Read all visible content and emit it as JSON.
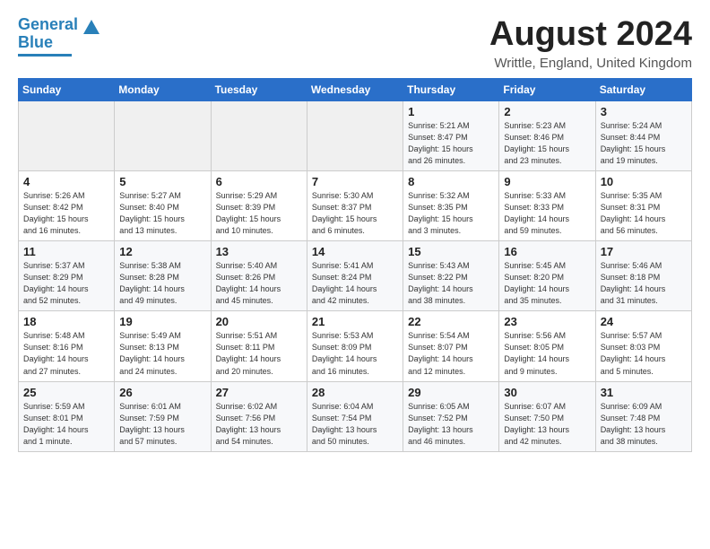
{
  "header": {
    "logo_line1": "General",
    "logo_line2": "Blue",
    "month_year": "August 2024",
    "location": "Writtle, England, United Kingdom"
  },
  "weekdays": [
    "Sunday",
    "Monday",
    "Tuesday",
    "Wednesday",
    "Thursday",
    "Friday",
    "Saturday"
  ],
  "weeks": [
    [
      {
        "day": "",
        "info": ""
      },
      {
        "day": "",
        "info": ""
      },
      {
        "day": "",
        "info": ""
      },
      {
        "day": "",
        "info": ""
      },
      {
        "day": "1",
        "info": "Sunrise: 5:21 AM\nSunset: 8:47 PM\nDaylight: 15 hours\nand 26 minutes."
      },
      {
        "day": "2",
        "info": "Sunrise: 5:23 AM\nSunset: 8:46 PM\nDaylight: 15 hours\nand 23 minutes."
      },
      {
        "day": "3",
        "info": "Sunrise: 5:24 AM\nSunset: 8:44 PM\nDaylight: 15 hours\nand 19 minutes."
      }
    ],
    [
      {
        "day": "4",
        "info": "Sunrise: 5:26 AM\nSunset: 8:42 PM\nDaylight: 15 hours\nand 16 minutes."
      },
      {
        "day": "5",
        "info": "Sunrise: 5:27 AM\nSunset: 8:40 PM\nDaylight: 15 hours\nand 13 minutes."
      },
      {
        "day": "6",
        "info": "Sunrise: 5:29 AM\nSunset: 8:39 PM\nDaylight: 15 hours\nand 10 minutes."
      },
      {
        "day": "7",
        "info": "Sunrise: 5:30 AM\nSunset: 8:37 PM\nDaylight: 15 hours\nand 6 minutes."
      },
      {
        "day": "8",
        "info": "Sunrise: 5:32 AM\nSunset: 8:35 PM\nDaylight: 15 hours\nand 3 minutes."
      },
      {
        "day": "9",
        "info": "Sunrise: 5:33 AM\nSunset: 8:33 PM\nDaylight: 14 hours\nand 59 minutes."
      },
      {
        "day": "10",
        "info": "Sunrise: 5:35 AM\nSunset: 8:31 PM\nDaylight: 14 hours\nand 56 minutes."
      }
    ],
    [
      {
        "day": "11",
        "info": "Sunrise: 5:37 AM\nSunset: 8:29 PM\nDaylight: 14 hours\nand 52 minutes."
      },
      {
        "day": "12",
        "info": "Sunrise: 5:38 AM\nSunset: 8:28 PM\nDaylight: 14 hours\nand 49 minutes."
      },
      {
        "day": "13",
        "info": "Sunrise: 5:40 AM\nSunset: 8:26 PM\nDaylight: 14 hours\nand 45 minutes."
      },
      {
        "day": "14",
        "info": "Sunrise: 5:41 AM\nSunset: 8:24 PM\nDaylight: 14 hours\nand 42 minutes."
      },
      {
        "day": "15",
        "info": "Sunrise: 5:43 AM\nSunset: 8:22 PM\nDaylight: 14 hours\nand 38 minutes."
      },
      {
        "day": "16",
        "info": "Sunrise: 5:45 AM\nSunset: 8:20 PM\nDaylight: 14 hours\nand 35 minutes."
      },
      {
        "day": "17",
        "info": "Sunrise: 5:46 AM\nSunset: 8:18 PM\nDaylight: 14 hours\nand 31 minutes."
      }
    ],
    [
      {
        "day": "18",
        "info": "Sunrise: 5:48 AM\nSunset: 8:16 PM\nDaylight: 14 hours\nand 27 minutes."
      },
      {
        "day": "19",
        "info": "Sunrise: 5:49 AM\nSunset: 8:13 PM\nDaylight: 14 hours\nand 24 minutes."
      },
      {
        "day": "20",
        "info": "Sunrise: 5:51 AM\nSunset: 8:11 PM\nDaylight: 14 hours\nand 20 minutes."
      },
      {
        "day": "21",
        "info": "Sunrise: 5:53 AM\nSunset: 8:09 PM\nDaylight: 14 hours\nand 16 minutes."
      },
      {
        "day": "22",
        "info": "Sunrise: 5:54 AM\nSunset: 8:07 PM\nDaylight: 14 hours\nand 12 minutes."
      },
      {
        "day": "23",
        "info": "Sunrise: 5:56 AM\nSunset: 8:05 PM\nDaylight: 14 hours\nand 9 minutes."
      },
      {
        "day": "24",
        "info": "Sunrise: 5:57 AM\nSunset: 8:03 PM\nDaylight: 14 hours\nand 5 minutes."
      }
    ],
    [
      {
        "day": "25",
        "info": "Sunrise: 5:59 AM\nSunset: 8:01 PM\nDaylight: 14 hours\nand 1 minute."
      },
      {
        "day": "26",
        "info": "Sunrise: 6:01 AM\nSunset: 7:59 PM\nDaylight: 13 hours\nand 57 minutes."
      },
      {
        "day": "27",
        "info": "Sunrise: 6:02 AM\nSunset: 7:56 PM\nDaylight: 13 hours\nand 54 minutes."
      },
      {
        "day": "28",
        "info": "Sunrise: 6:04 AM\nSunset: 7:54 PM\nDaylight: 13 hours\nand 50 minutes."
      },
      {
        "day": "29",
        "info": "Sunrise: 6:05 AM\nSunset: 7:52 PM\nDaylight: 13 hours\nand 46 minutes."
      },
      {
        "day": "30",
        "info": "Sunrise: 6:07 AM\nSunset: 7:50 PM\nDaylight: 13 hours\nand 42 minutes."
      },
      {
        "day": "31",
        "info": "Sunrise: 6:09 AM\nSunset: 7:48 PM\nDaylight: 13 hours\nand 38 minutes."
      }
    ]
  ]
}
